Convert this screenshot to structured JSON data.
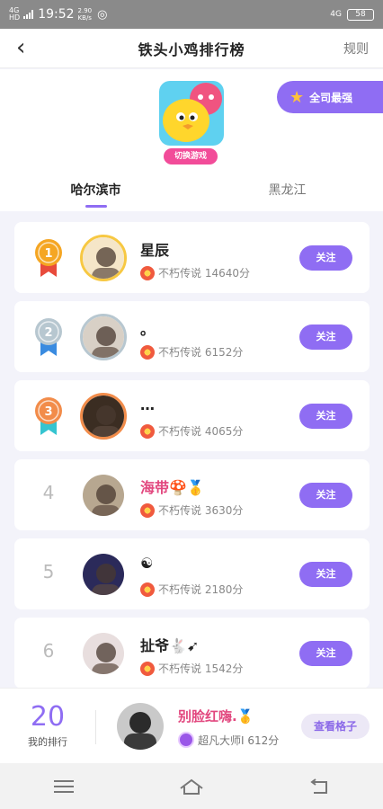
{
  "status_bar": {
    "network_label": "4G HD",
    "time": "19:52",
    "speed": "2.90\nKB/s",
    "net_right": "4G",
    "battery": "58"
  },
  "header": {
    "title": "铁头小鸡排行榜",
    "rules": "规则"
  },
  "game": {
    "switch_label": "切换游戏",
    "all_star_label": "全司最强"
  },
  "tabs": [
    {
      "label": "哈尔滨市",
      "active": true
    },
    {
      "label": "黑龙江",
      "active": false
    }
  ],
  "ranking": [
    {
      "rank": "1",
      "medal_color": "#f5a623",
      "ribbon_color": "#e84b3c",
      "name": "星辰",
      "name_color": "normal",
      "score_label": "不朽传说 14640分",
      "avatar_border": "#f7c842"
    },
    {
      "rank": "2",
      "medal_color": "#b7c7d0",
      "ribbon_color": "#3a8be0",
      "name": "。",
      "name_color": "normal",
      "score_label": "不朽传说 6152分",
      "avatar_border": "#b7c7d0"
    },
    {
      "rank": "3",
      "medal_color": "#f28c4a",
      "ribbon_color": "#35c4d0",
      "name": "…",
      "name_color": "normal",
      "score_label": "不朽传说 4065分",
      "avatar_border": "#f28c4a"
    },
    {
      "rank": "4",
      "name": "海带🍄🥇",
      "name_color": "pink",
      "score_label": "不朽传说 3630分"
    },
    {
      "rank": "5",
      "name": "☯",
      "name_color": "normal",
      "score_label": "不朽传说 2180分"
    },
    {
      "rank": "6",
      "name": "扯爷🐇➹",
      "name_color": "normal",
      "score_label": "不朽传说 1542分"
    }
  ],
  "follow_label": "关注",
  "my": {
    "rank": "20",
    "rank_label": "我的排行",
    "name": "别脸红嗨.🥇",
    "level_label": "超凡大师I 612分",
    "view_button": "查看格子"
  }
}
